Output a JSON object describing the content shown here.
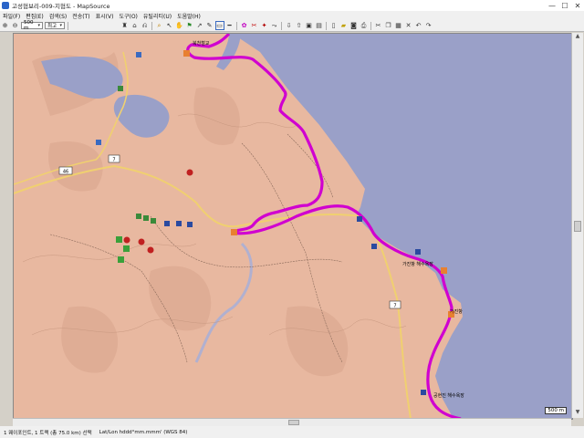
{
  "window": {
    "title": "고성협보리-009-지협도 - MapSource",
    "minimize": "—",
    "maximize": "☐",
    "close": "✕"
  },
  "menu": [
    "파일(F)",
    "편집(E)",
    "검색(S)",
    "전송(T)",
    "표시(V)",
    "도구(O)",
    "유틸리티(U)",
    "도움말(H)"
  ],
  "toolbar": {
    "scale_select": "500 m",
    "detail_select": "최고"
  },
  "map": {
    "labels": [
      "북천철교",
      "가진항 해수욕장",
      "가진항",
      "공현진 해수욕장"
    ],
    "road_numbers": [
      "46",
      "7"
    ],
    "scale": "500 m",
    "colors": {
      "sea": "#9aa0c8",
      "land": "#e8b8a0",
      "track": "#d000d0"
    }
  },
  "status": {
    "selection": "1 웨이포인트, 1 트랙 (총 75.0 km) 선택",
    "coords": "Lat/Lon hddd°mm.mmm' (WGS 84)"
  }
}
